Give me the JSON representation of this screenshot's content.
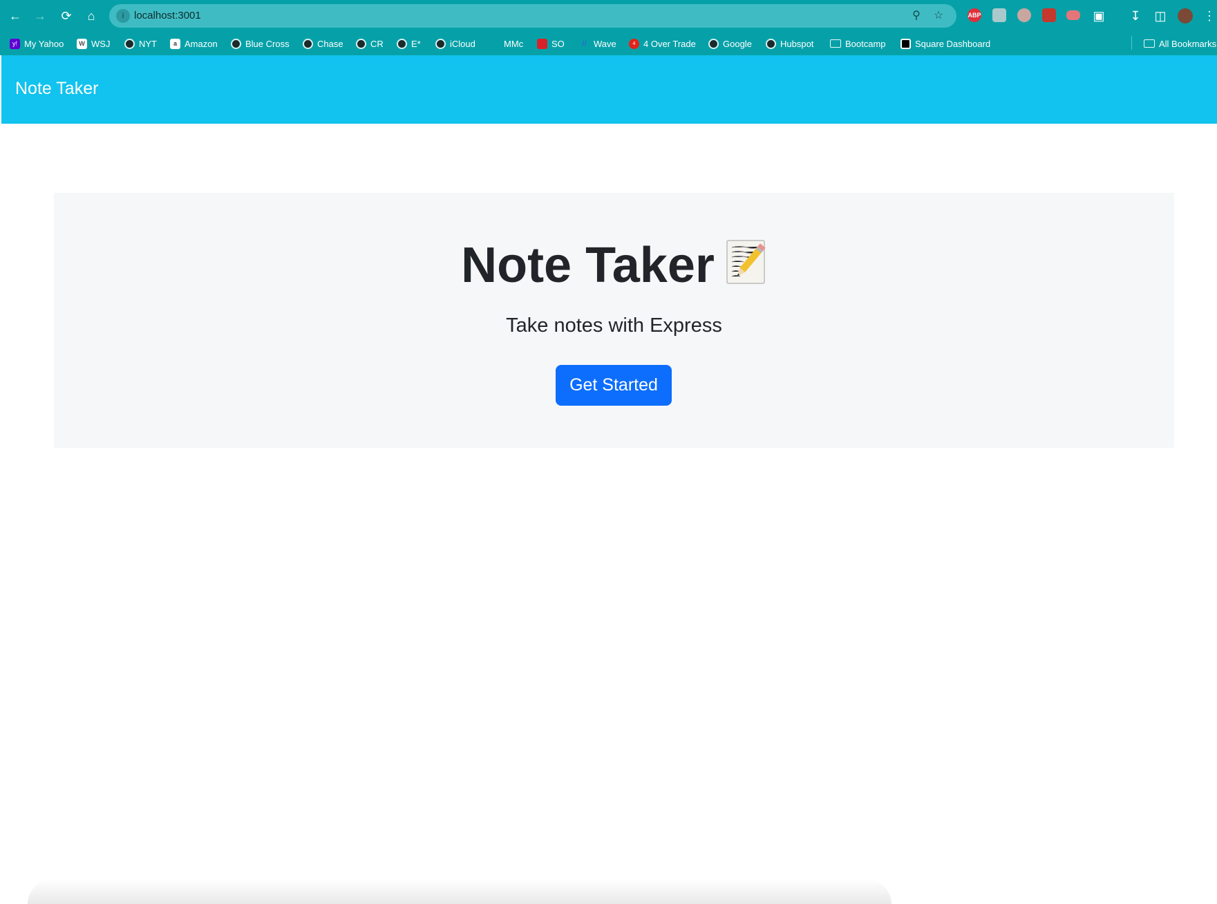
{
  "browser": {
    "url": "localhost:3001",
    "bookmarks": [
      {
        "label": "My Yahoo",
        "icon": "yahoo-icon"
      },
      {
        "label": "WSJ",
        "icon": "wsj-icon"
      },
      {
        "label": "NYT",
        "icon": "globe-icon"
      },
      {
        "label": "Amazon",
        "icon": "amazon-icon"
      },
      {
        "label": "Blue Cross",
        "icon": "globe-icon"
      },
      {
        "label": "Chase",
        "icon": "globe-icon"
      },
      {
        "label": "CR",
        "icon": "globe-icon"
      },
      {
        "label": "E*",
        "icon": "globe-icon"
      },
      {
        "label": "iCloud",
        "icon": "globe-icon"
      },
      {
        "label": "MMc",
        "icon": "apple-icon"
      },
      {
        "label": "SO",
        "icon": "so-icon"
      },
      {
        "label": "Wave",
        "icon": "wave-icon"
      },
      {
        "label": "4 Over Trade",
        "icon": "4over-icon"
      },
      {
        "label": "Google",
        "icon": "globe-icon"
      },
      {
        "label": "Hubspot",
        "icon": "globe-icon"
      },
      {
        "label": "Bootcamp",
        "icon": "folder-icon"
      },
      {
        "label": "Square Dashboard",
        "icon": "square-icon"
      }
    ],
    "all_bookmarks_label": "All Bookmarks",
    "extensions": {
      "abp_label": "ABP"
    },
    "colors": {
      "chrome": "#06a1a8",
      "omnibox": "#3fbcc3"
    }
  },
  "app": {
    "brand": "Note Taker",
    "hero": {
      "title": "Note Taker",
      "title_icon": "memo-pencil-icon",
      "subtitle": "Take notes with Express",
      "cta_label": "Get Started"
    },
    "colors": {
      "navbar": "#11c3ee",
      "jumbotron": "#f6f7f9",
      "primary_button": "#0d6efd"
    }
  }
}
